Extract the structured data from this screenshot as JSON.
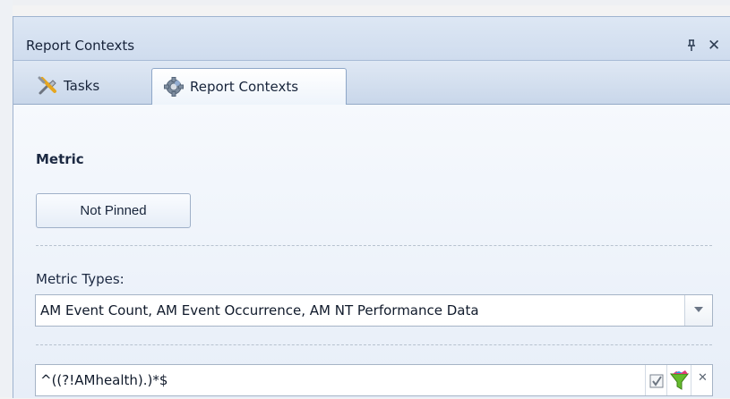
{
  "panel": {
    "title": "Report Contexts",
    "pin_glyph": "⊥",
    "close_glyph": "✕"
  },
  "tabs": [
    {
      "label": "Tasks",
      "icon": "tools-icon",
      "active": false
    },
    {
      "label": "Report Contexts",
      "icon": "gear-icon",
      "active": true
    }
  ],
  "metric": {
    "section_title": "Metric",
    "pin_button_label": "Not Pinned"
  },
  "metric_types": {
    "label": "Metric Types:",
    "selected_value": "AM Event Count, AM Event Occurrence, AM NT Performance Data"
  },
  "filter": {
    "value": "^((?!AMhealth).)*$",
    "actions": [
      "check-icon",
      "funnel-icon",
      "clear-icon"
    ],
    "clear_glyph": "✕"
  },
  "colors": {
    "accent": "#1d63a8",
    "panel_background": "#e8eef7",
    "border": "#9fb3cf"
  }
}
